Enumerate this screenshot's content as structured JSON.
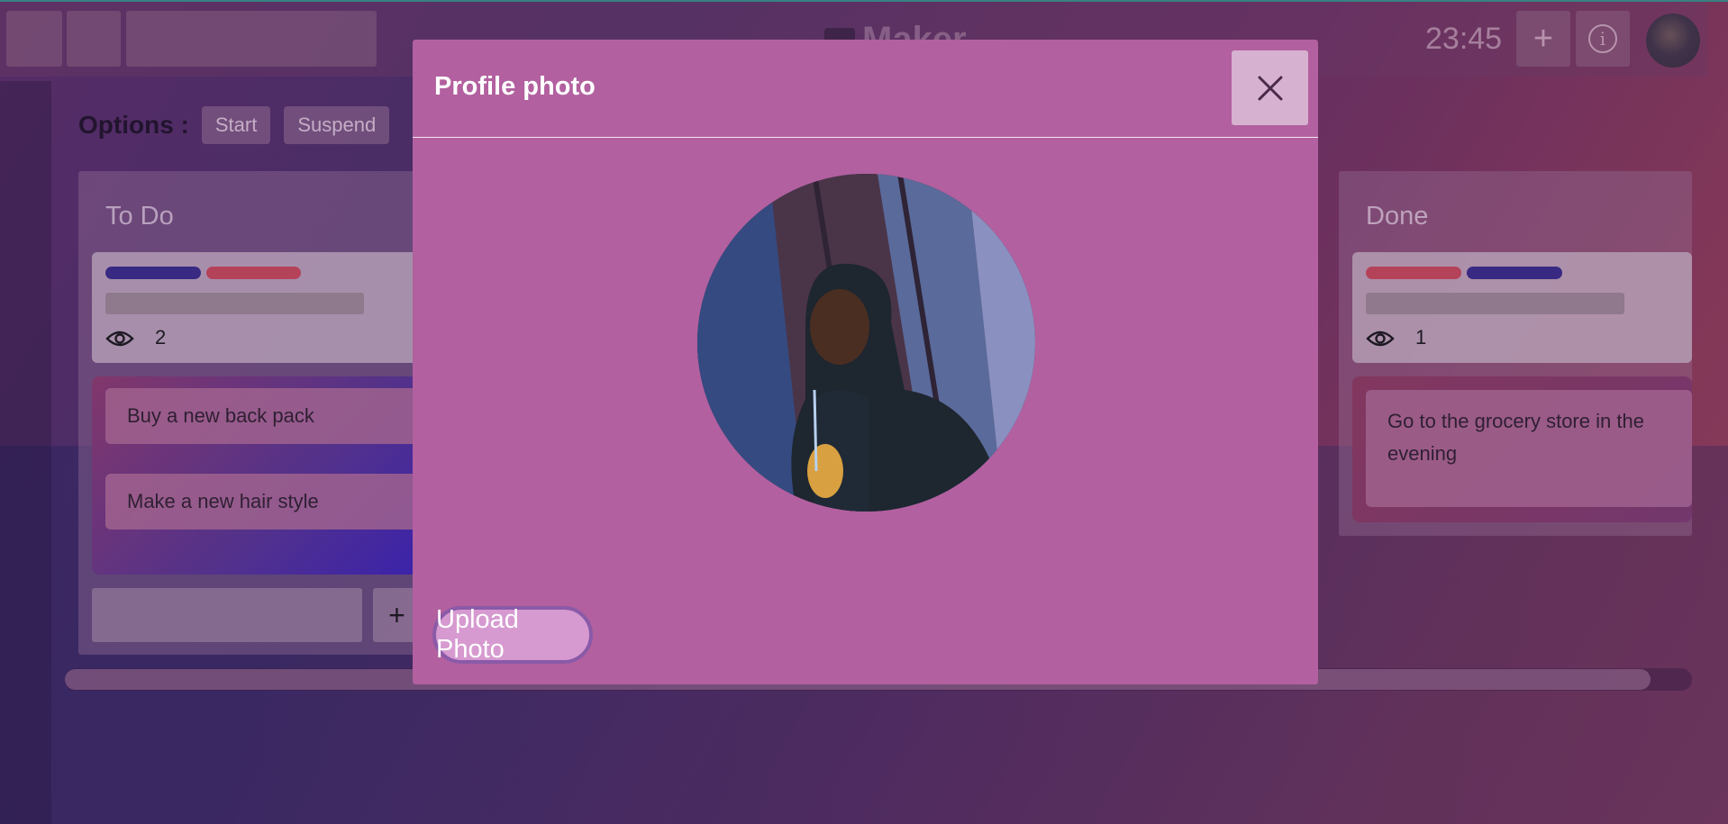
{
  "header": {
    "logo_text": "Maker",
    "clock": "23:45",
    "add_icon": "plus-icon",
    "info_icon": "info-icon"
  },
  "options": {
    "label": "Options :",
    "buttons": [
      "Start",
      "Suspend"
    ]
  },
  "board": {
    "columns": [
      {
        "title": "To Do",
        "card_tags": [
          "blue",
          "red"
        ],
        "watchers": "2",
        "tasks": [
          "Buy a new back pack",
          "Make a new hair style"
        ],
        "add_label": "+"
      },
      {
        "title": "Done",
        "card_tags": [
          "red",
          "blue"
        ],
        "watchers": "1",
        "tasks": [
          "Go to the grocery store in the evening"
        ]
      }
    ]
  },
  "modal": {
    "title": "Profile photo",
    "close_icon": "close-icon",
    "upload_label": "Upload Photo"
  },
  "colors": {
    "modal_bg": "#b2609f",
    "tag_blue": "#3a2c8a",
    "tag_red": "#c0475e",
    "upload_btn": "#d69ad0"
  }
}
